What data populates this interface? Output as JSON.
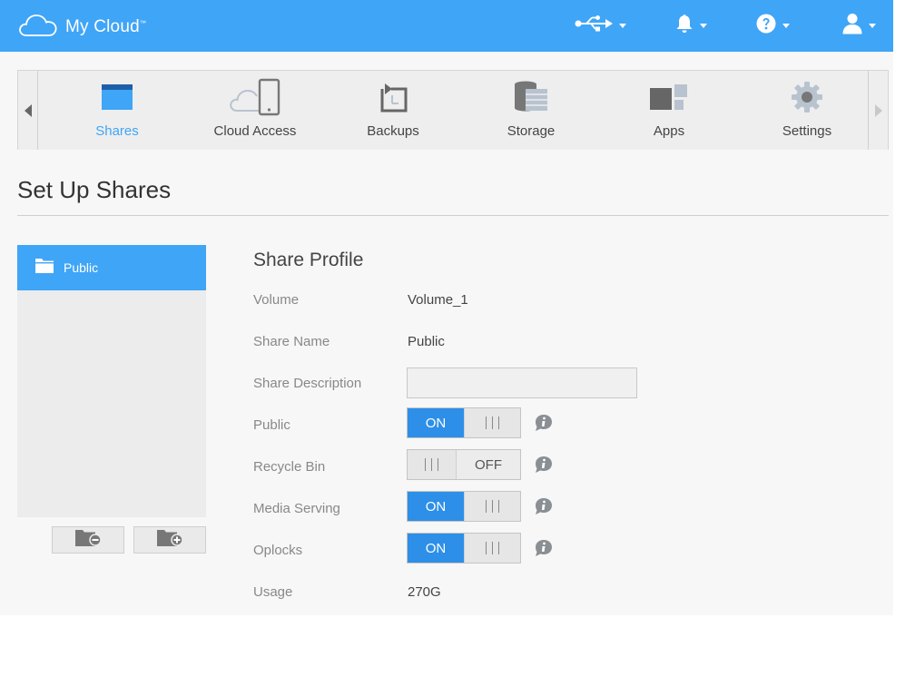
{
  "brand": {
    "name": "My Cloud",
    "tm": "™"
  },
  "topbar": {
    "icons": [
      "usb-icon",
      "bell-icon",
      "help-icon",
      "user-icon"
    ]
  },
  "apps": [
    {
      "label": "Shares",
      "icon": "folder-icon",
      "active": true
    },
    {
      "label": "Cloud Access",
      "icon": "cloud-device-icon",
      "active": false
    },
    {
      "label": "Backups",
      "icon": "backup-icon",
      "active": false
    },
    {
      "label": "Storage",
      "icon": "storage-icon",
      "active": false
    },
    {
      "label": "Apps",
      "icon": "apps-icon",
      "active": false
    },
    {
      "label": "Settings",
      "icon": "gear-icon",
      "active": false
    }
  ],
  "page": {
    "title": "Set Up Shares"
  },
  "shares": [
    {
      "name": "Public",
      "selected": true
    }
  ],
  "share_buttons": {
    "remove_icon": "folder-remove-icon",
    "add_icon": "folder-add-icon"
  },
  "profile": {
    "title": "Share Profile",
    "volume_label": "Volume",
    "volume_value": "Volume_1",
    "name_label": "Share Name",
    "name_value": "Public",
    "desc_label": "Share Description",
    "desc_value": "",
    "public_label": "Public",
    "public_state": "ON",
    "recycle_label": "Recycle Bin",
    "recycle_state": "OFF",
    "media_label": "Media Serving",
    "media_state": "ON",
    "oplocks_label": "Oplocks",
    "oplocks_state": "ON",
    "usage_label": "Usage",
    "usage_value": "270G"
  },
  "colors": {
    "accent": "#3fa5f7",
    "toggle_on": "#2d8fe7",
    "panel_bg": "#f7f7f7"
  }
}
